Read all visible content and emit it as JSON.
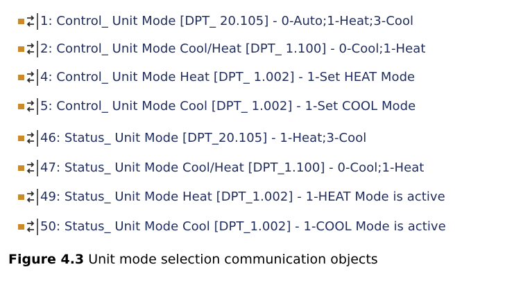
{
  "objects": [
    {
      "text": "1: Control_ Unit Mode [DPT_ 20.105] - 0-Auto;1-Heat;3-Cool",
      "icon": "communication-object-icon"
    },
    {
      "text": "2: Control_ Unit Mode Cool/Heat [DPT_ 1.100] - 0-Cool;1-Heat",
      "icon": "communication-object-icon"
    },
    {
      "text": "4: Control_ Unit Mode Heat [DPT_ 1.002] - 1-Set HEAT Mode",
      "icon": "communication-object-icon"
    },
    {
      "text": "5: Control_ Unit Mode Cool [DPT_ 1.002] - 1-Set COOL Mode",
      "icon": "communication-object-icon"
    },
    {
      "text": "46: Status_ Unit Mode [DPT_20.105] - 1-Heat;3-Cool",
      "icon": "communication-object-icon"
    },
    {
      "text": "47: Status_ Unit Mode Cool/Heat [DPT_1.100] - 0-Cool;1-Heat",
      "icon": "communication-object-icon"
    },
    {
      "text": "49: Status_ Unit Mode Heat [DPT_1.002] - 1-HEAT Mode is active",
      "icon": "communication-object-icon"
    },
    {
      "text": "50: Status_ Unit Mode Cool [DPT_1.002] - 1-COOL Mode is active",
      "icon": "communication-object-icon"
    }
  ],
  "caption": {
    "label": "Figure 4.3",
    "text": "Unit mode selection communication objects"
  },
  "colors": {
    "text": "#1f2c5d",
    "icon_square": "#c98a2c",
    "icon_arrows": "#303030"
  }
}
